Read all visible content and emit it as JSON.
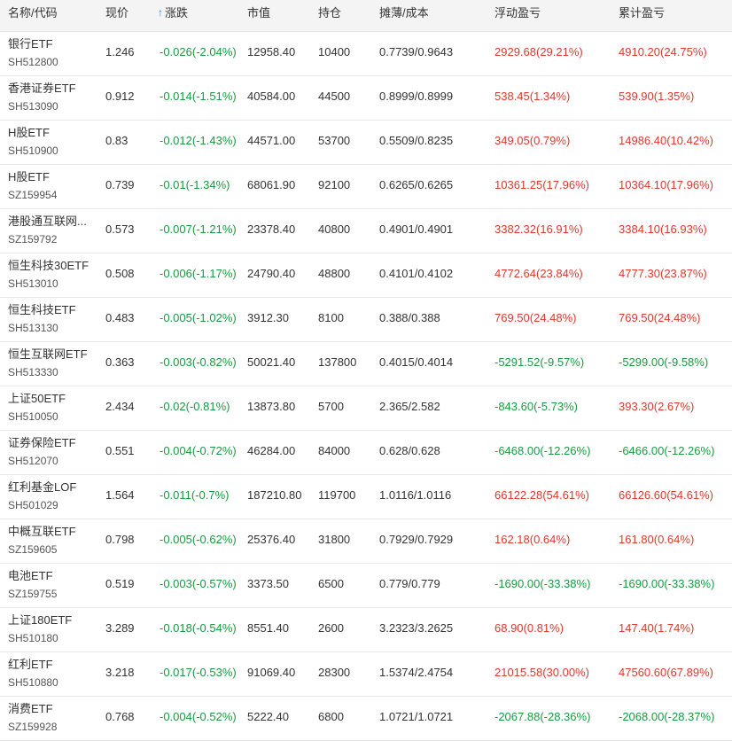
{
  "colors": {
    "up": "#e0382c",
    "down": "#1a9a3f",
    "sort_arrow": "#1e88e5",
    "header_bg": "#f4f4f4"
  },
  "header": {
    "name_code": "名称/代码",
    "price": "现价",
    "change": "涨跌",
    "market_value": "市值",
    "position": "持仓",
    "cost": "摊薄/成本",
    "float_pl": "浮动盈亏",
    "cum_pl": "累计盈亏",
    "sort_icon": "arrow-up-icon"
  },
  "rows": [
    {
      "name": "银行ETF",
      "code": "SH512800",
      "price": "1.246",
      "change": "-0.026(-2.04%)",
      "mv": "12958.40",
      "pos": "10400",
      "cost": "0.7739/0.9643",
      "float": "2929.68(29.21%)",
      "float_dir": "up",
      "cum": "4910.20(24.75%)",
      "cum_dir": "up"
    },
    {
      "name": "香港证券ETF",
      "code": "SH513090",
      "price": "0.912",
      "change": "-0.014(-1.51%)",
      "mv": "40584.00",
      "pos": "44500",
      "cost": "0.8999/0.8999",
      "float": "538.45(1.34%)",
      "float_dir": "up",
      "cum": "539.90(1.35%)",
      "cum_dir": "up"
    },
    {
      "name": "H股ETF",
      "code": "SH510900",
      "price": "0.83",
      "change": "-0.012(-1.43%)",
      "mv": "44571.00",
      "pos": "53700",
      "cost": "0.5509/0.8235",
      "float": "349.05(0.79%)",
      "float_dir": "up",
      "cum": "14986.40(10.42%)",
      "cum_dir": "up"
    },
    {
      "name": "H股ETF",
      "code": "SZ159954",
      "price": "0.739",
      "change": "-0.01(-1.34%)",
      "mv": "68061.90",
      "pos": "92100",
      "cost": "0.6265/0.6265",
      "float": "10361.25(17.96%)",
      "float_dir": "up",
      "cum": "10364.10(17.96%)",
      "cum_dir": "up"
    },
    {
      "name": "港股通互联网...",
      "code": "SZ159792",
      "price": "0.573",
      "change": "-0.007(-1.21%)",
      "mv": "23378.40",
      "pos": "40800",
      "cost": "0.4901/0.4901",
      "float": "3382.32(16.91%)",
      "float_dir": "up",
      "cum": "3384.10(16.93%)",
      "cum_dir": "up"
    },
    {
      "name": "恒生科技30ETF",
      "code": "SH513010",
      "price": "0.508",
      "change": "-0.006(-1.17%)",
      "mv": "24790.40",
      "pos": "48800",
      "cost": "0.4101/0.4102",
      "float": "4772.64(23.84%)",
      "float_dir": "up",
      "cum": "4777.30(23.87%)",
      "cum_dir": "up"
    },
    {
      "name": "恒生科技ETF",
      "code": "SH513130",
      "price": "0.483",
      "change": "-0.005(-1.02%)",
      "mv": "3912.30",
      "pos": "8100",
      "cost": "0.388/0.388",
      "float": "769.50(24.48%)",
      "float_dir": "up",
      "cum": "769.50(24.48%)",
      "cum_dir": "up"
    },
    {
      "name": "恒生互联网ETF",
      "code": "SH513330",
      "price": "0.363",
      "change": "-0.003(-0.82%)",
      "mv": "50021.40",
      "pos": "137800",
      "cost": "0.4015/0.4014",
      "float": "-5291.52(-9.57%)",
      "float_dir": "down",
      "cum": "-5299.00(-9.58%)",
      "cum_dir": "down"
    },
    {
      "name": "上证50ETF",
      "code": "SH510050",
      "price": "2.434",
      "change": "-0.02(-0.81%)",
      "mv": "13873.80",
      "pos": "5700",
      "cost": "2.365/2.582",
      "float": "-843.60(-5.73%)",
      "float_dir": "down",
      "cum": "393.30(2.67%)",
      "cum_dir": "up"
    },
    {
      "name": "证券保险ETF",
      "code": "SH512070",
      "price": "0.551",
      "change": "-0.004(-0.72%)",
      "mv": "46284.00",
      "pos": "84000",
      "cost": "0.628/0.628",
      "float": "-6468.00(-12.26%)",
      "float_dir": "down",
      "cum": "-6466.00(-12.26%)",
      "cum_dir": "down"
    },
    {
      "name": "红利基金LOF",
      "code": "SH501029",
      "price": "1.564",
      "change": "-0.011(-0.7%)",
      "mv": "187210.80",
      "pos": "119700",
      "cost": "1.0116/1.0116",
      "float": "66122.28(54.61%)",
      "float_dir": "up",
      "cum": "66126.60(54.61%)",
      "cum_dir": "up"
    },
    {
      "name": "中概互联ETF",
      "code": "SZ159605",
      "price": "0.798",
      "change": "-0.005(-0.62%)",
      "mv": "25376.40",
      "pos": "31800",
      "cost": "0.7929/0.7929",
      "float": "162.18(0.64%)",
      "float_dir": "up",
      "cum": "161.80(0.64%)",
      "cum_dir": "up"
    },
    {
      "name": "电池ETF",
      "code": "SZ159755",
      "price": "0.519",
      "change": "-0.003(-0.57%)",
      "mv": "3373.50",
      "pos": "6500",
      "cost": "0.779/0.779",
      "float": "-1690.00(-33.38%)",
      "float_dir": "down",
      "cum": "-1690.00(-33.38%)",
      "cum_dir": "down"
    },
    {
      "name": "上证180ETF",
      "code": "SH510180",
      "price": "3.289",
      "change": "-0.018(-0.54%)",
      "mv": "8551.40",
      "pos": "2600",
      "cost": "3.2323/3.2625",
      "float": "68.90(0.81%)",
      "float_dir": "up",
      "cum": "147.40(1.74%)",
      "cum_dir": "up"
    },
    {
      "name": "红利ETF",
      "code": "SH510880",
      "price": "3.218",
      "change": "-0.017(-0.53%)",
      "mv": "91069.40",
      "pos": "28300",
      "cost": "1.5374/2.4754",
      "float": "21015.58(30.00%)",
      "float_dir": "up",
      "cum": "47560.60(67.89%)",
      "cum_dir": "up"
    },
    {
      "name": "消费ETF",
      "code": "SZ159928",
      "price": "0.768",
      "change": "-0.004(-0.52%)",
      "mv": "5222.40",
      "pos": "6800",
      "cost": "1.0721/1.0721",
      "float": "-2067.88(-28.36%)",
      "float_dir": "down",
      "cum": "-2068.00(-28.37%)",
      "cum_dir": "down"
    }
  ]
}
